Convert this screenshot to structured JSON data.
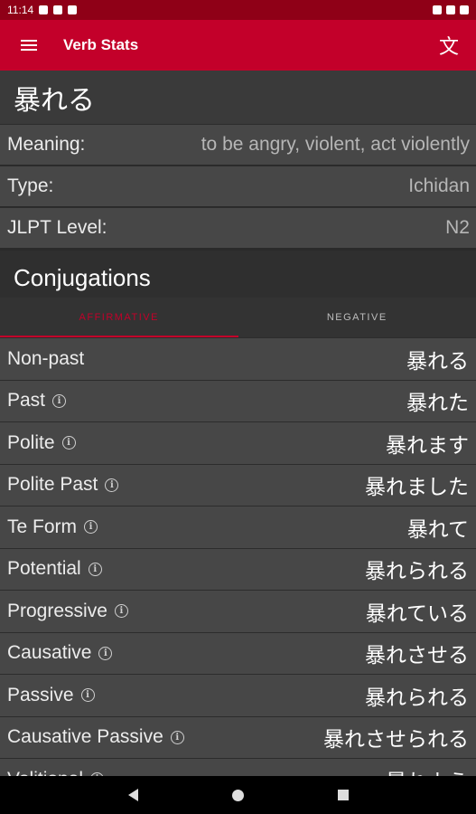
{
  "status_bar": {
    "time": "11:14"
  },
  "app_bar": {
    "title": "Verb Stats",
    "translate_glyph": "文"
  },
  "verb": {
    "kanji": "暴れる"
  },
  "details": [
    {
      "label": "Meaning:",
      "value": "to be angry, violent, act violently"
    },
    {
      "label": "Type:",
      "value": "Ichidan"
    },
    {
      "label": "JLPT Level:",
      "value": "N2"
    }
  ],
  "conjugations": {
    "heading": "Conjugations",
    "tabs": [
      {
        "label": "AFFIRMATIVE"
      },
      {
        "label": "NEGATIVE"
      }
    ],
    "rows": [
      {
        "name": "Non-past",
        "form": "暴れる"
      },
      {
        "name": "Past",
        "form": "暴れた"
      },
      {
        "name": "Polite",
        "form": "暴れます"
      },
      {
        "name": "Polite Past",
        "form": "暴れました"
      },
      {
        "name": "Te Form",
        "form": "暴れて"
      },
      {
        "name": "Potential",
        "form": "暴れられる"
      },
      {
        "name": "Progressive",
        "form": "暴れている"
      },
      {
        "name": "Causative",
        "form": "暴れさせる"
      },
      {
        "name": "Passive",
        "form": "暴れられる"
      },
      {
        "name": "Causative Passive",
        "form": "暴れさせられる"
      },
      {
        "name": "Volitional",
        "form": "暴れよう"
      }
    ]
  },
  "icons": {
    "menu": "menu-icon",
    "translate": "translate-icon",
    "info": "info-icon",
    "nav_back": "back-triangle-icon",
    "nav_home": "home-circle-icon",
    "nav_recents": "recents-square-icon"
  },
  "colors": {
    "accent": "#c3002a",
    "status_bar": "#8f0017",
    "row_bg": "#474747",
    "background": "#2a2a2a"
  }
}
